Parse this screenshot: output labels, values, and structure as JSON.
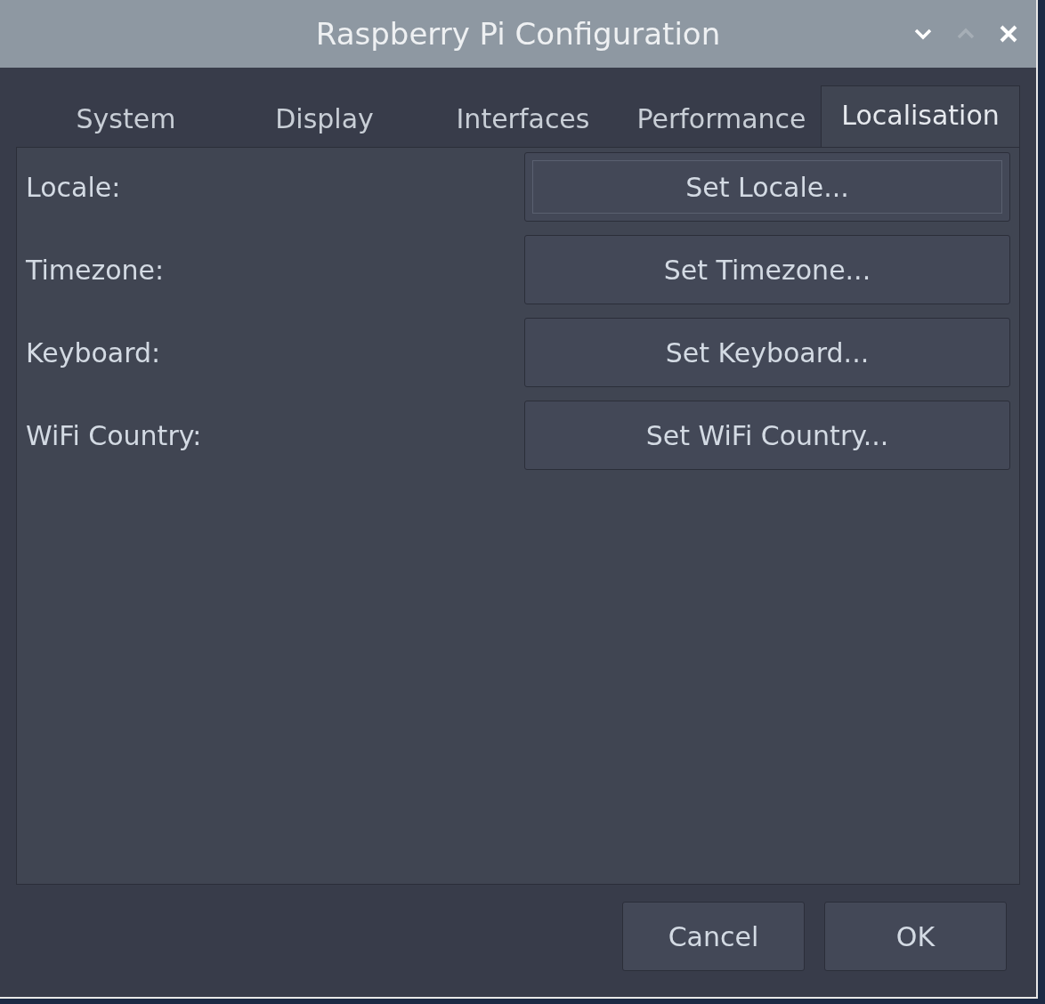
{
  "window": {
    "title": "Raspberry Pi Configuration"
  },
  "tabs": [
    {
      "label": "System",
      "selected": false
    },
    {
      "label": "Display",
      "selected": false
    },
    {
      "label": "Interfaces",
      "selected": false
    },
    {
      "label": "Performance",
      "selected": false
    },
    {
      "label": "Localisation",
      "selected": true
    }
  ],
  "settings": [
    {
      "label": "Locale:",
      "button": "Set Locale...",
      "focused": true
    },
    {
      "label": "Timezone:",
      "button": "Set Timezone...",
      "focused": false
    },
    {
      "label": "Keyboard:",
      "button": "Set Keyboard...",
      "focused": false
    },
    {
      "label": "WiFi Country:",
      "button": "Set WiFi Country...",
      "focused": false
    }
  ],
  "buttons": [
    "Cancel",
    "OK"
  ]
}
